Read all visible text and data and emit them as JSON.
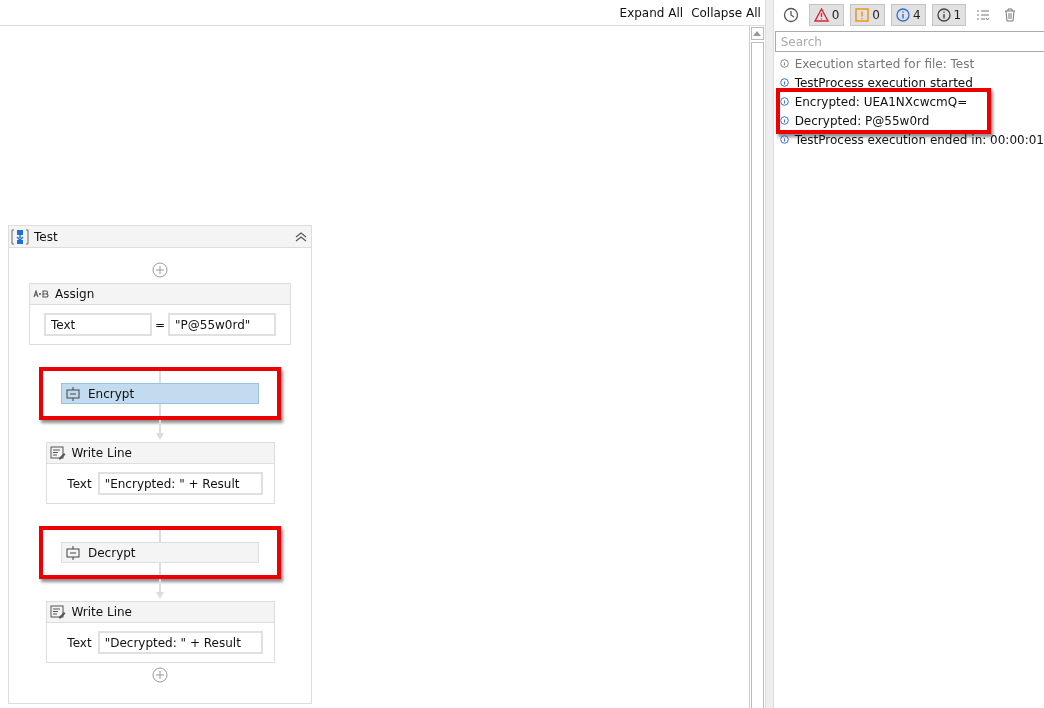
{
  "designer": {
    "toolbar": [
      "Expand All",
      "Collapse All"
    ],
    "sequence": {
      "title": "Test",
      "activities": [
        {
          "kind": "assign",
          "title": "Assign",
          "to": "Text",
          "operator": "=",
          "value": "\"P@55w0rd\"",
          "selected": false,
          "highlighted": false
        },
        {
          "kind": "invoke",
          "title": "Encrypt",
          "selected": true,
          "highlighted": true
        },
        {
          "kind": "writeline",
          "title": "Write Line",
          "label": "Text",
          "value": "\"Encrypted: \" + Result",
          "selected": false,
          "highlighted": false
        },
        {
          "kind": "invoke",
          "title": "Decrypt",
          "selected": false,
          "highlighted": true
        },
        {
          "kind": "writeline",
          "title": "Write Line",
          "label": "Text",
          "value": "\"Decrypted: \" + Result",
          "selected": false,
          "highlighted": false
        }
      ]
    }
  },
  "output": {
    "filters": [
      {
        "kind": "error",
        "count": "0",
        "selected": true
      },
      {
        "kind": "warning",
        "count": "0",
        "selected": true
      },
      {
        "kind": "info",
        "count": "4",
        "selected": true
      },
      {
        "kind": "trace",
        "count": "1",
        "selected": true
      }
    ],
    "search": {
      "placeholder": "Search"
    },
    "entries": [
      {
        "kind": "trace",
        "text": "Execution started for file: Test",
        "highlighted": false
      },
      {
        "kind": "info",
        "text": "TestProcess execution started",
        "highlighted": false
      },
      {
        "kind": "info",
        "text": "Encrypted: UEA1NXcwcmQ=",
        "highlighted": true
      },
      {
        "kind": "info",
        "text": "Decrypted: P@55w0rd",
        "highlighted": true
      },
      {
        "kind": "info",
        "text": "TestProcess execution ended in: 00:00:01",
        "highlighted": false
      }
    ]
  }
}
